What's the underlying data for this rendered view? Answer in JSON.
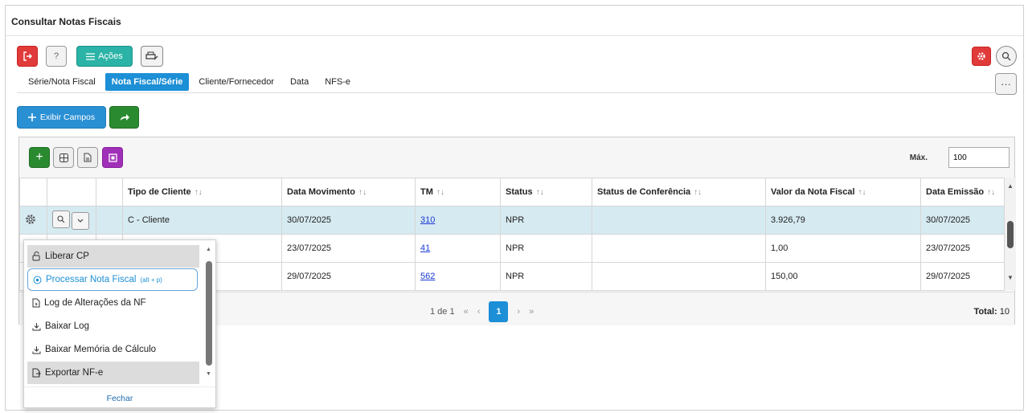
{
  "window": {
    "title": "Consultar Notas Fiscais"
  },
  "toolbar": {
    "exit_icon": "logout-icon",
    "help_label": "?",
    "acoes_label": "Ações",
    "acoes_icon": "menu-lines-icon",
    "print_icon": "printer-icon",
    "gear_icon": "gear-icon",
    "search_icon": "search-icon",
    "more_label": "···"
  },
  "tabs": [
    {
      "label": "Série/Nota Fiscal",
      "active": false
    },
    {
      "label": "Nota Fiscal/Série",
      "active": true
    },
    {
      "label": "Cliente/Fornecedor",
      "active": false
    },
    {
      "label": "Data",
      "active": false
    },
    {
      "label": "NFS-e",
      "active": false
    }
  ],
  "actions": {
    "exibir_label": "Exibir Campos",
    "exibir_icon": "plus-icon",
    "share_icon": "share-arrow-icon"
  },
  "grid": {
    "max_label": "Máx.",
    "max_value": "100",
    "columns": [
      "Tipo de Cliente",
      "Data Movimento",
      "TM",
      "Status",
      "Status de Conferência",
      "Valor da Nota Fiscal",
      "Data Emissão"
    ],
    "rows": [
      {
        "tipo": "C - Cliente",
        "data_mov": "30/07/2025",
        "tm": "310",
        "status": "NPR",
        "conf": "",
        "valor": "3.926,79",
        "emissao": "30/07/2025"
      },
      {
        "tipo": "",
        "data_mov": "23/07/2025",
        "tm": "41",
        "status": "NPR",
        "conf": "",
        "valor": "1,00",
        "emissao": "23/07/2025"
      },
      {
        "tipo": "",
        "data_mov": "29/07/2025",
        "tm": "562",
        "status": "NPR",
        "conf": "",
        "valor": "150,00",
        "emissao": "29/07/2025"
      }
    ],
    "pager": {
      "page_info": "1 de 1",
      "first": "«",
      "prev": "‹",
      "current": "1",
      "next": "›",
      "last": "»"
    },
    "total_label": "Total:",
    "total_value": "10"
  },
  "menu": {
    "items": [
      {
        "label": "Liberar CP",
        "icon": "unlock-icon"
      },
      {
        "label": "Processar Nota Fiscal",
        "shortcut": "(alt + p)",
        "icon": "process-icon"
      },
      {
        "label": "Log de Alterações da NF",
        "icon": "log-icon"
      },
      {
        "label": "Baixar Log",
        "icon": "download-icon"
      },
      {
        "label": "Baixar Memória de Cálculo",
        "icon": "download-icon"
      },
      {
        "label": "Exportar NF-e",
        "icon": "export-icon"
      }
    ],
    "close_label": "Fechar"
  }
}
